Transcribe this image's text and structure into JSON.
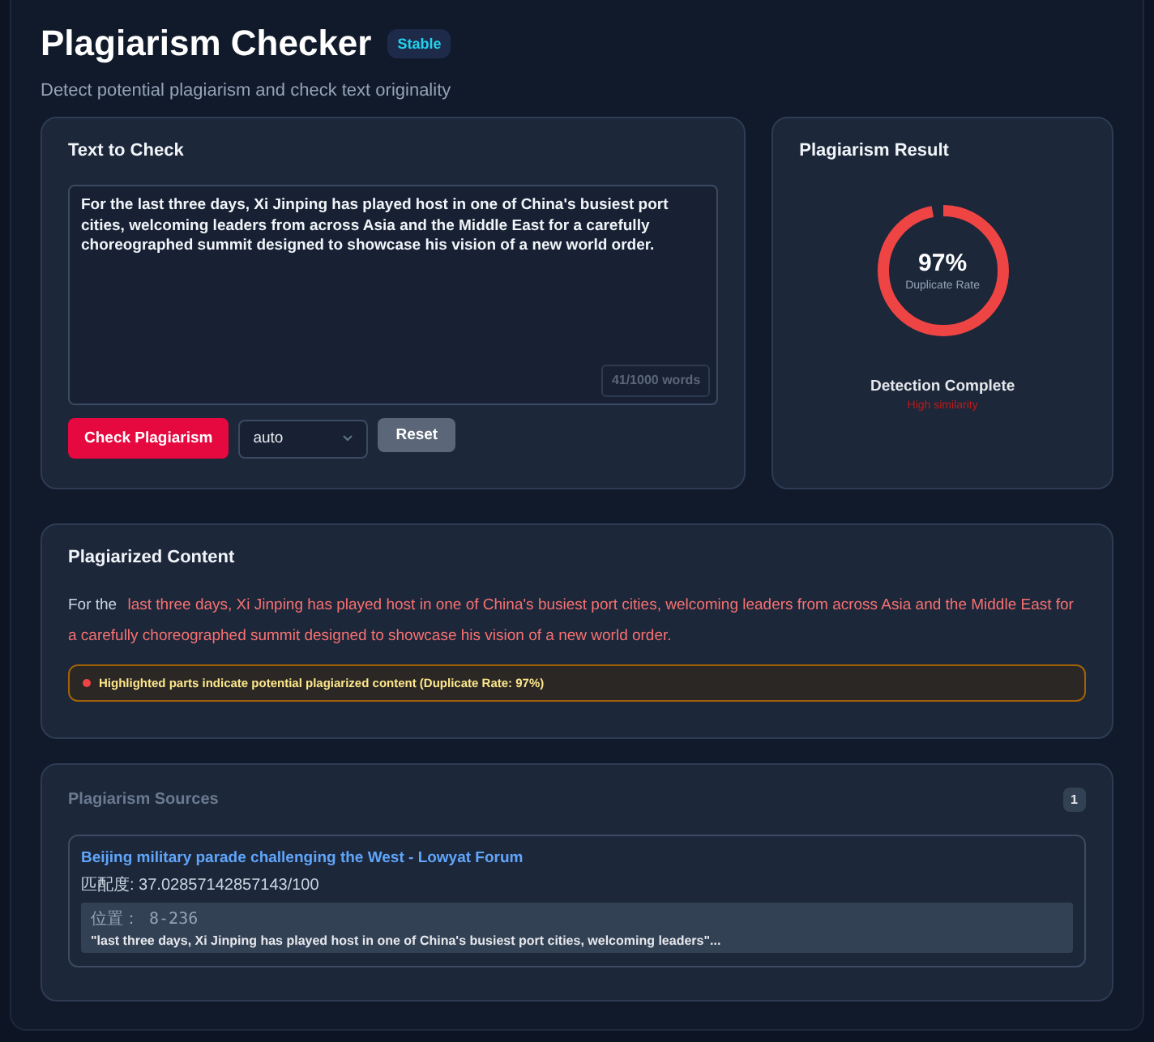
{
  "header": {
    "title": "Plagiarism Checker",
    "badge": "Stable",
    "subtitle": "Detect potential plagiarism and check text originality"
  },
  "input_panel": {
    "title": "Text to Check",
    "text": "For the last three days, Xi Jinping has played host in one of China's busiest port cities, welcoming leaders from across Asia and the Middle East for a carefully choreographed summit designed to showcase his vision of a new world order.",
    "word_count": "41/1000 words",
    "check_button": "Check Plagiarism",
    "language_select": "auto",
    "reset_button": "Reset"
  },
  "result_panel": {
    "title": "Plagiarism Result",
    "rate": "97%",
    "level": 0.97,
    "rate_label": "Duplicate Rate",
    "status": "Detection Complete",
    "verdict": "High similarity"
  },
  "content_panel": {
    "title": "Plagiarized Content",
    "segments": [
      {
        "text": "For the",
        "highlighted": false
      },
      {
        "text": "last three days, Xi Jinping has played host in one of China's busiest port cities, welcoming leaders from across Asia and the Middle East for a carefully choreographed summit designed to showcase his vision of a new world order.",
        "highlighted": true
      }
    ],
    "notice": "Highlighted parts indicate potential plagiarized content (Duplicate Rate: 97%)"
  },
  "sources_panel": {
    "title": "Plagiarism Sources",
    "count": "1",
    "sources": [
      {
        "title": "Beijing military parade challenging the West - Lowyat Forum",
        "match": "匹配度: 37.02857142857143/100",
        "position": "位置： 8-236",
        "excerpt": "\"last three days, Xi Jinping has played host in one of China's busiest port cities, welcoming leaders\"..."
      }
    ]
  }
}
